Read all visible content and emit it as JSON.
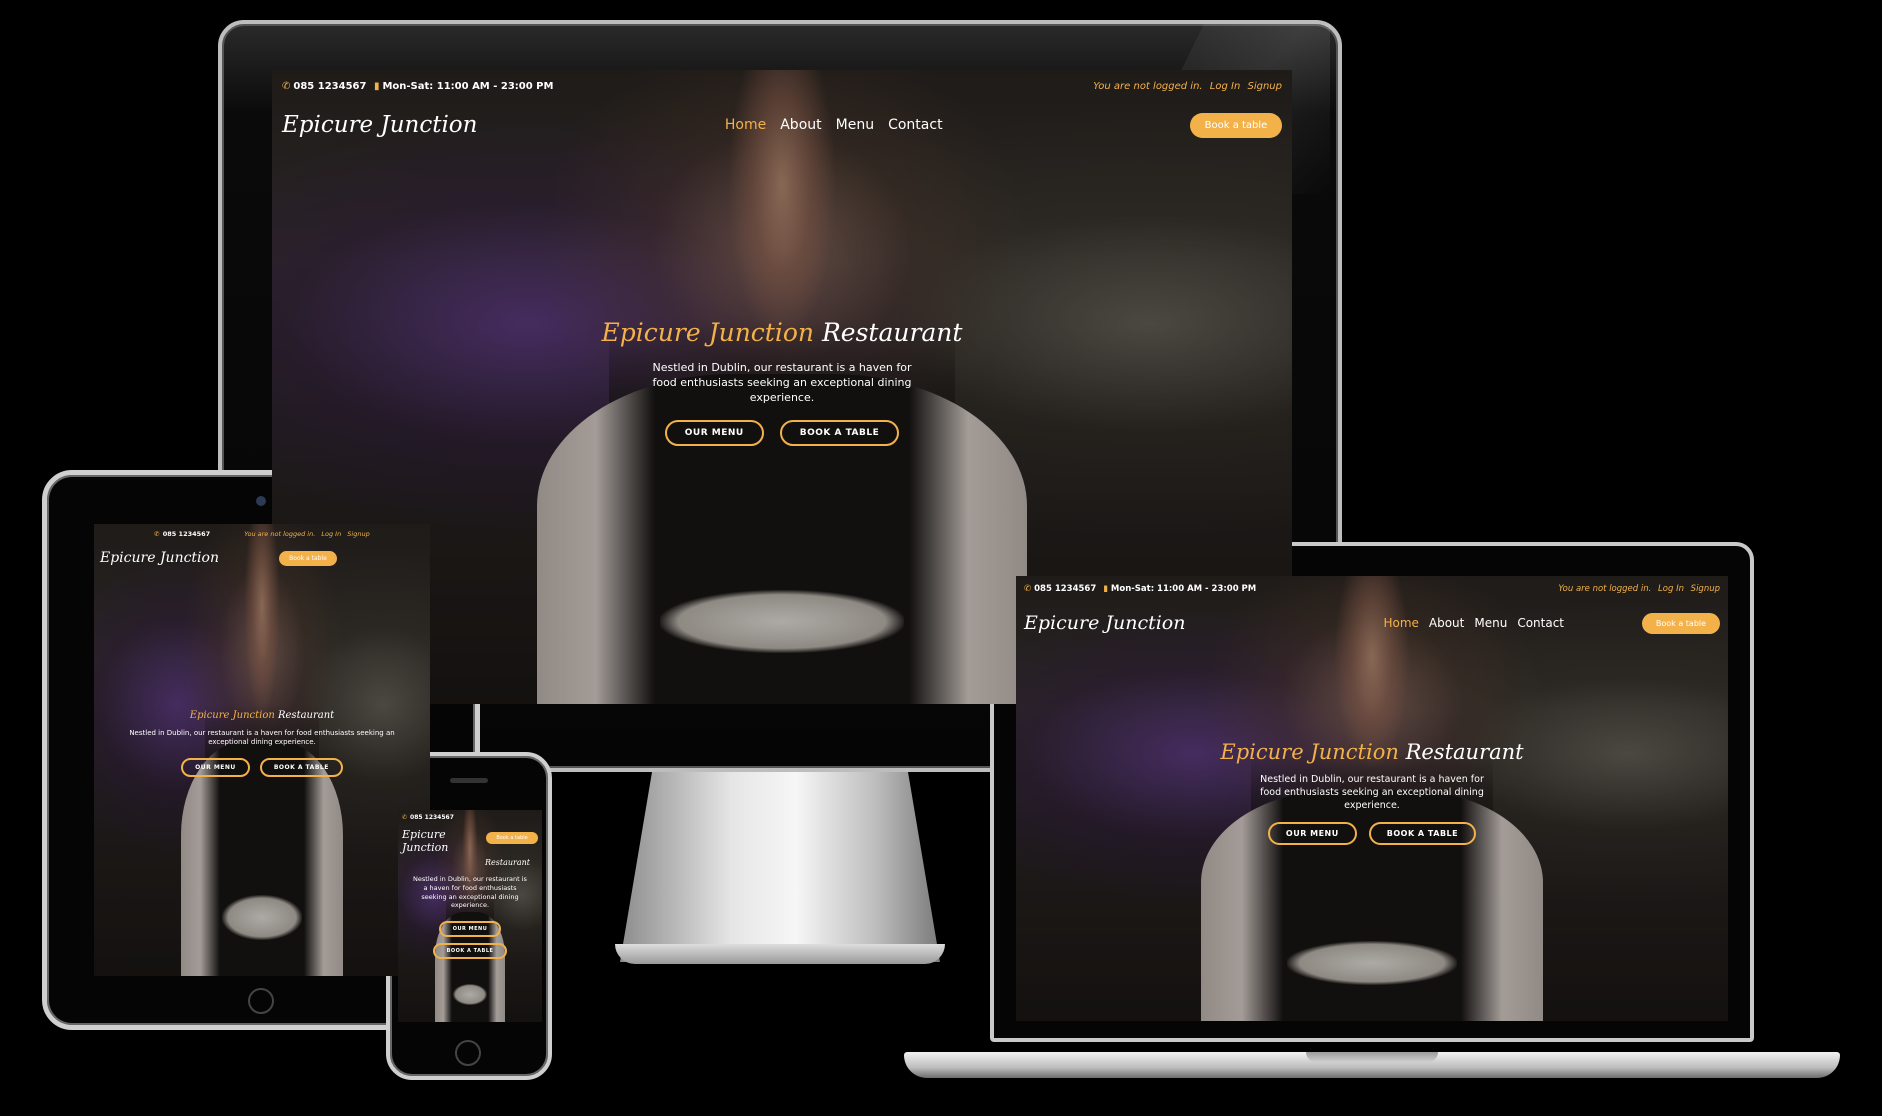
{
  "site": {
    "phone": "085 1234567",
    "hours": "Mon-Sat: 11:00 AM - 23:00 PM",
    "login_status": "You are not logged in.",
    "login_link": "Log In",
    "signup_link": "Signup",
    "logo": "Epicure Junction",
    "nav": [
      "Home",
      "About",
      "Menu",
      "Contact"
    ],
    "book_button": "Book a table",
    "hero_brand": "Epicure Junction",
    "hero_rest": "Restaurant",
    "hero_text": "Nestled in Dublin, our restaurant is a haven for food enthusiasts seeking an exceptional dining experience.",
    "btn_menu": "OUR MENU",
    "btn_book": "BOOK A TABLE"
  },
  "icons": {
    "phone": "phone-icon",
    "clock": "clock-icon"
  },
  "colors": {
    "accent": "#f3b14a",
    "background": "#000000"
  }
}
